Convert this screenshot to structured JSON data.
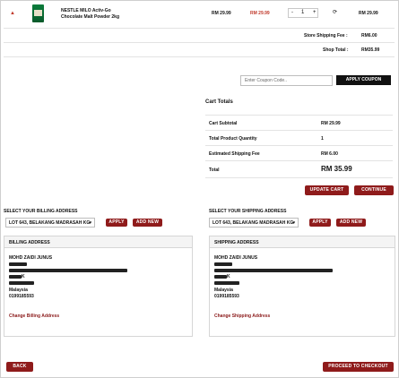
{
  "cart_item": {
    "name_line1": "NESTLE MILO Activ-Go",
    "name_line2": "Chocolate Malt Powder 2kg",
    "price": "RM 29.99",
    "sale_price": "RM 29.99",
    "qty_minus": "-",
    "quantity": "1",
    "qty_plus": "+",
    "line_total": "RM 29.99"
  },
  "shop_summary": {
    "shipping_label": "Store Shipping Fee :",
    "shipping_value": "RM6.00",
    "total_label": "Shop Total :",
    "total_value": "RM35.99"
  },
  "coupon": {
    "placeholder": "Enter Coupon Code..",
    "button": "APPLY COUPON"
  },
  "cart_totals": {
    "title": "Cart Totals",
    "rows": [
      {
        "label": "Cart Subtotal",
        "value": "RM 29.99"
      },
      {
        "label": "Total Product Quantity",
        "value": "1"
      },
      {
        "label": "Estimated Shipping Fee",
        "value": "RM 6.00"
      }
    ],
    "total_label": "Total",
    "total_value": "RM 35.99",
    "update_button": "UPDATE CART",
    "continue_button": "CONTINUE"
  },
  "billing": {
    "select_label": "SELECT YOUR BILLING ADDRESS",
    "selected": "LOT 643, BELAKANG MADRASAH KG",
    "apply": "APPLY",
    "add_new": "ADD NEW",
    "heading": "BILLING ADDRESS",
    "name": "MOHD ZAIDI JUNUS",
    "city_suffix": "K",
    "country": "Malaysia",
    "phone": "0199185593",
    "change_link": "Change Billing Address"
  },
  "shipping": {
    "select_label": "SELECT YOUR SHIPPING ADDRESS",
    "selected": "LOT 643, BELAKANG MADRASAH KG",
    "apply": "APPLY",
    "add_new": "ADD NEW",
    "heading": "SHIPPING ADDRESS",
    "name": "MOHD ZAIDI JUNUS",
    "city_suffix": "K",
    "country": "Malaysia",
    "phone": "0199185593",
    "change_link": "Change Shipping Address"
  },
  "footer": {
    "back": "BACK",
    "checkout": "PROCEED TO CHECKOUT"
  }
}
